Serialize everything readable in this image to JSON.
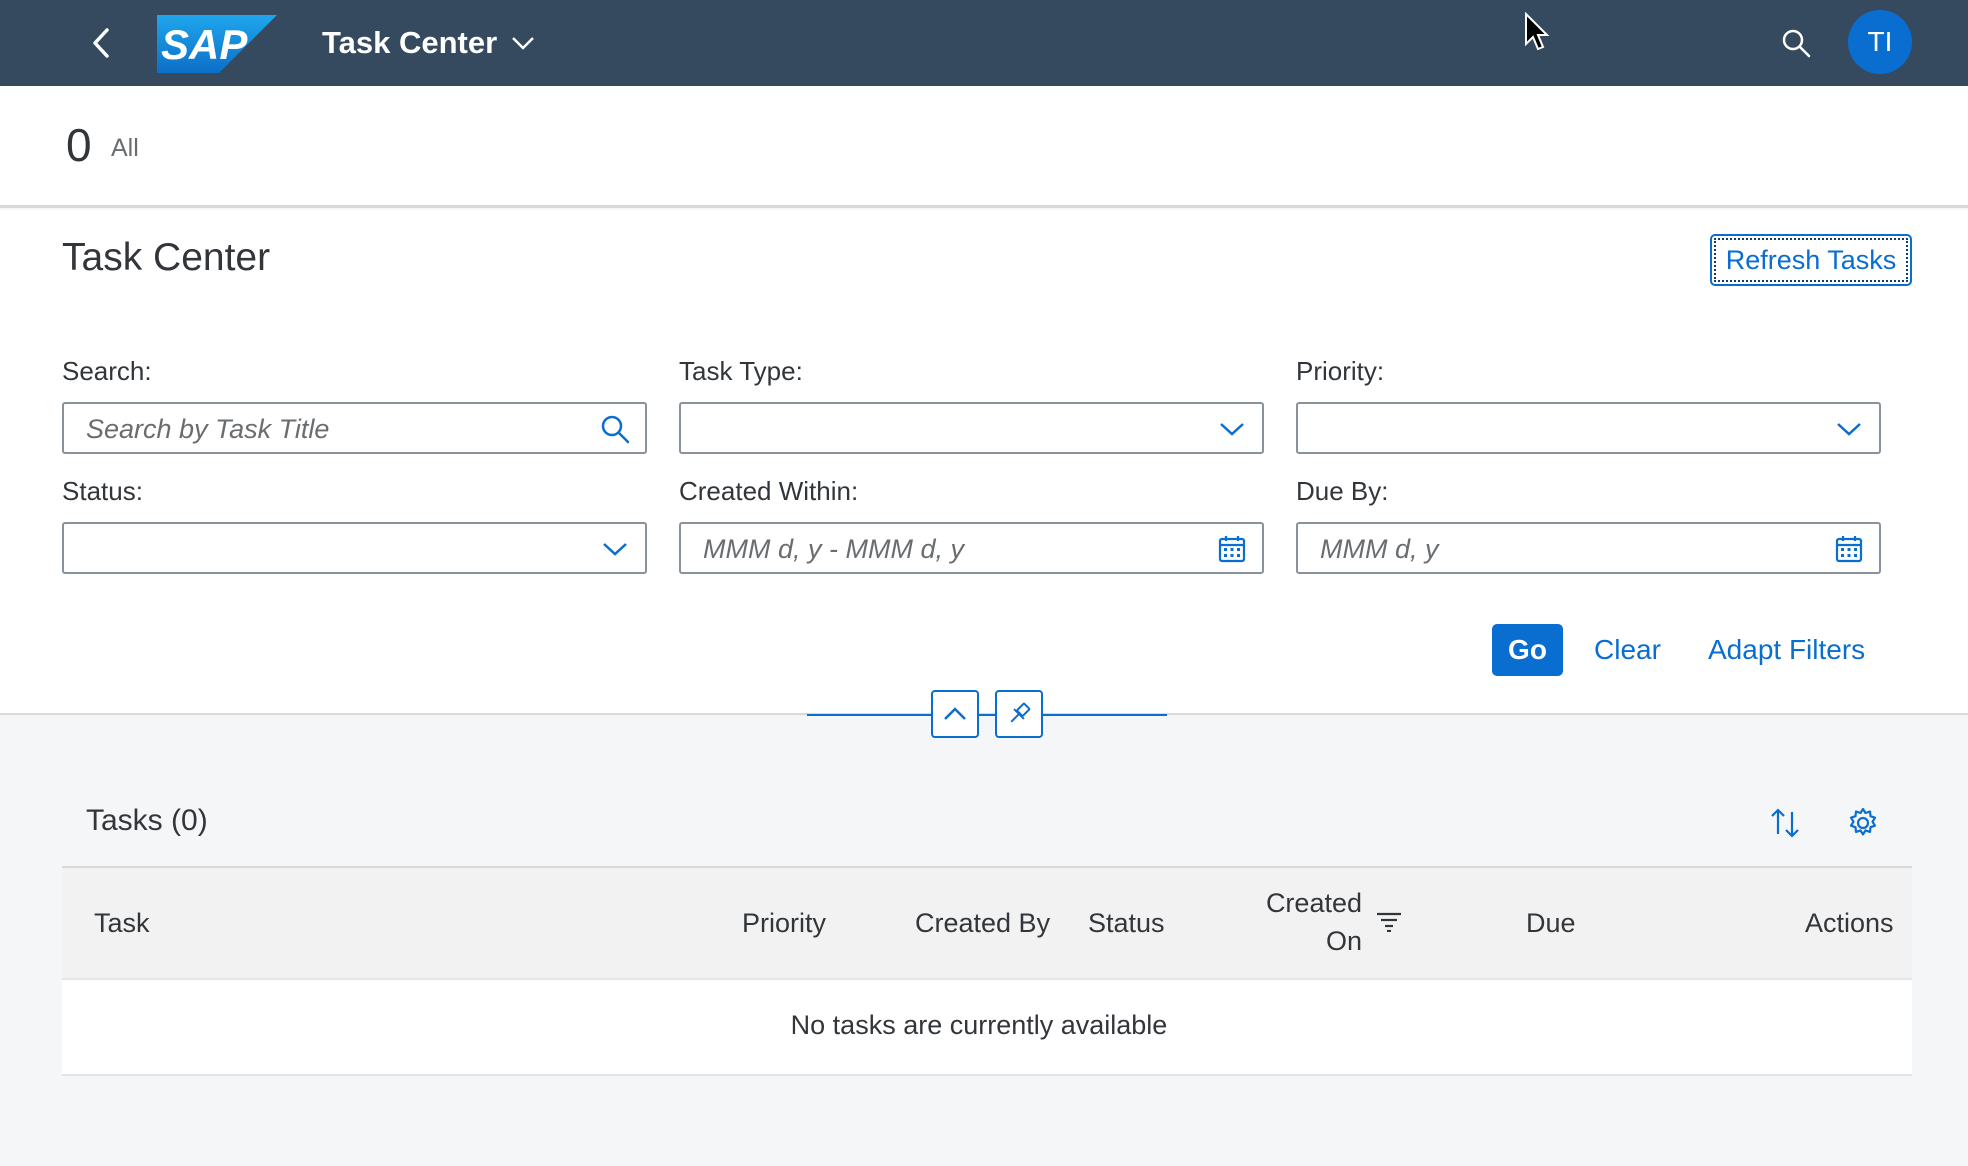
{
  "shell": {
    "app_title": "Task Center",
    "avatar_initials": "TI",
    "logo_text": "SAP"
  },
  "count_bar": {
    "count": "0",
    "label": "All"
  },
  "page": {
    "title": "Task Center",
    "refresh_label": "Refresh Tasks"
  },
  "filters": {
    "search": {
      "label": "Search:",
      "placeholder": "Search by Task Title"
    },
    "task_type": {
      "label": "Task Type:",
      "value": ""
    },
    "priority": {
      "label": "Priority:",
      "value": ""
    },
    "status": {
      "label": "Status:",
      "value": ""
    },
    "created_within": {
      "label": "Created Within:",
      "placeholder": "MMM d, y - MMM d, y"
    },
    "due_by": {
      "label": "Due By:",
      "placeholder": "MMM d, y"
    },
    "go_label": "Go",
    "clear_label": "Clear",
    "adapt_label": "Adapt Filters"
  },
  "table": {
    "title": "Tasks (0)",
    "columns": {
      "task": "Task",
      "priority": "Priority",
      "created_by": "Created By",
      "status": "Status",
      "created_on_1": "Created",
      "created_on_2": "On",
      "due": "Due",
      "actions": "Actions"
    },
    "empty_message": "No tasks are currently available"
  },
  "colors": {
    "shell_bg": "#354a5f",
    "accent": "#0a6ed1",
    "page_bg": "#f5f6f7"
  }
}
